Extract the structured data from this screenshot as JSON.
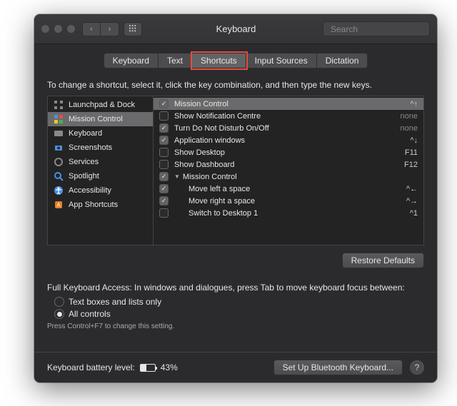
{
  "window": {
    "title": "Keyboard",
    "search_placeholder": "Search"
  },
  "tabs": [
    {
      "label": "Keyboard"
    },
    {
      "label": "Text"
    },
    {
      "label": "Shortcuts",
      "selected": true,
      "highlighted": true
    },
    {
      "label": "Input Sources"
    },
    {
      "label": "Dictation"
    }
  ],
  "instruction": "To change a shortcut, select it, click the key combination, and then type the new keys.",
  "sidebar": {
    "items": [
      {
        "label": "Launchpad & Dock",
        "icon": "launchpad"
      },
      {
        "label": "Mission Control",
        "icon": "mission-control",
        "selected": true
      },
      {
        "label": "Keyboard",
        "icon": "keyboard"
      },
      {
        "label": "Screenshots",
        "icon": "screenshots"
      },
      {
        "label": "Services",
        "icon": "services"
      },
      {
        "label": "Spotlight",
        "icon": "spotlight"
      },
      {
        "label": "Accessibility",
        "icon": "accessibility"
      },
      {
        "label": "App Shortcuts",
        "icon": "app-shortcuts"
      }
    ]
  },
  "list": {
    "rows": [
      {
        "checked": true,
        "label": "Mission Control",
        "key": "^↑",
        "selected": true
      },
      {
        "checked": false,
        "label": "Show Notification Centre",
        "key": "none",
        "none": true
      },
      {
        "checked": true,
        "label": "Turn Do Not Disturb On/Off",
        "key": "none",
        "none": true
      },
      {
        "checked": true,
        "label": "Application windows",
        "key": "^↓"
      },
      {
        "checked": false,
        "label": "Show Desktop",
        "key": "F11"
      },
      {
        "checked": false,
        "label": "Show Dashboard",
        "key": "F12"
      },
      {
        "checked": true,
        "label": "Mission Control",
        "key": "",
        "group": true
      },
      {
        "checked": true,
        "label": "Move left a space",
        "key": "^←",
        "indent": true
      },
      {
        "checked": true,
        "label": "Move right a space",
        "key": "^→",
        "indent": true
      },
      {
        "checked": false,
        "label": "Switch to Desktop 1",
        "key": "^1",
        "indent": true
      }
    ]
  },
  "restore": {
    "label": "Restore Defaults"
  },
  "fka": {
    "title": "Full Keyboard Access: In windows and dialogues, press Tab to move keyboard focus between:",
    "opt1": "Text boxes and lists only",
    "opt2": "All controls",
    "selected": "opt2",
    "hint": "Press Control+F7 to change this setting."
  },
  "footer": {
    "battery_label": "Keyboard battery level:",
    "battery_pct": "43%",
    "battery_fill": 43,
    "bt_button": "Set Up Bluetooth Keyboard...",
    "help": "?"
  }
}
